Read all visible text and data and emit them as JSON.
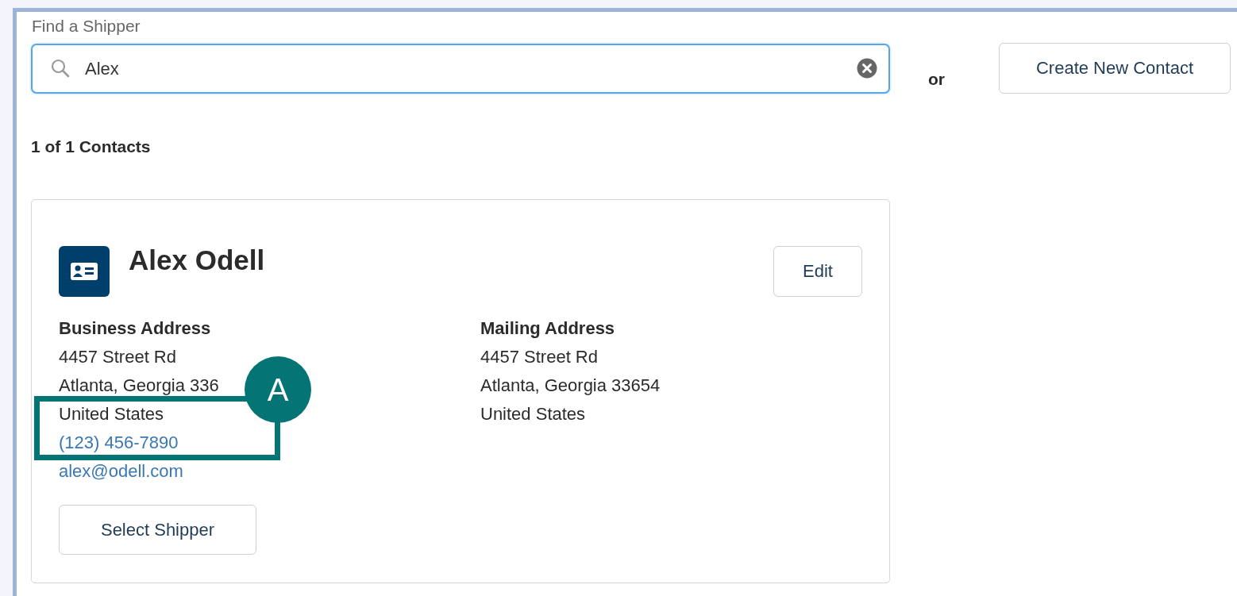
{
  "search": {
    "label": "Find a Shipper",
    "value": "Alex"
  },
  "separator": "or",
  "create_button": "Create New Contact",
  "result_count": "1 of 1 Contacts",
  "contacts": [
    {
      "name": "Alex Odell",
      "edit_button": "Edit",
      "business_address": {
        "heading": "Business Address",
        "lines": [
          "4457 Street Rd",
          "Atlanta, Georgia 336",
          "United States"
        ],
        "phone": "(123) 456-7890",
        "email": "alex@odell.com"
      },
      "mailing_address": {
        "heading": "Mailing Address",
        "lines": [
          "4457 Street Rd",
          "Atlanta, Georgia 33654",
          "United States"
        ]
      },
      "select_button": "Select Shipper"
    }
  ],
  "annotation": {
    "label": "A"
  }
}
